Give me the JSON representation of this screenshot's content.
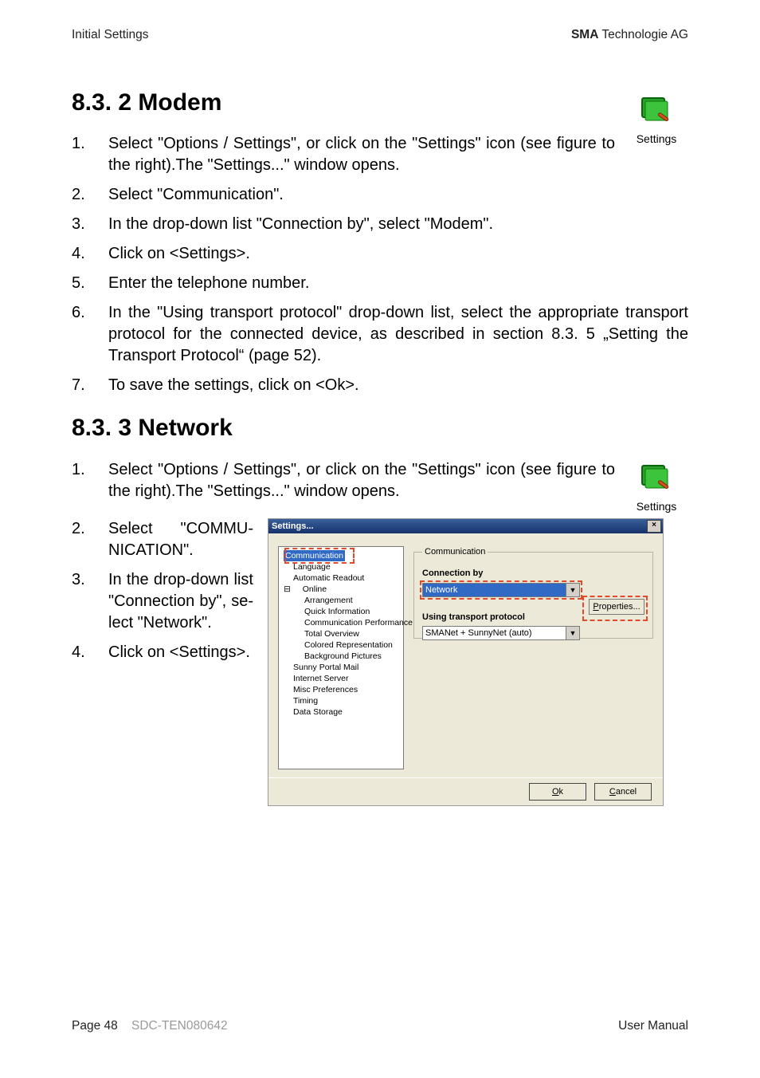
{
  "header": {
    "left": "Initial Settings",
    "right_bold": "SMA",
    "right_rest": " Technologie AG"
  },
  "icon": {
    "caption": "Settings"
  },
  "section_modem": {
    "heading": "8.3. 2 Modem",
    "steps": [
      "Select \"Options / Settings\", or click on the \"Settings\" icon (see figure to the right).The \"Settings...\" window opens.",
      "Select \"Communication\".",
      "In the drop-down list \"Connection by\", select \"Modem\".",
      "Click on <Settings>.",
      "Enter the telephone number.",
      "In the \"Using transport protocol\" drop-down list, select the appropriate transport protocol for the connected device, as described in section 8.3. 5 „Setting the Transport Protocol“ (page 52).",
      "To save the settings, click on <Ok>."
    ]
  },
  "section_network": {
    "heading": "8.3. 3 Network",
    "steps_top": [
      "Select \"Options / Settings\", or click on the \"Settings\" icon (see figure to the right).The \"Settings...\" window opens."
    ],
    "steps_left": [
      "Select \"COMMU-NICATION\".",
      "In the drop-down list \"Connection by\", se­lect \"Network\".",
      "Click on <Settings>."
    ]
  },
  "dialog": {
    "title": "Settings...",
    "tree": {
      "items": [
        {
          "label": "Communication",
          "lvl": 0,
          "selected": true
        },
        {
          "label": "Language",
          "lvl": 1
        },
        {
          "label": "Automatic Readout",
          "lvl": 1
        },
        {
          "label": "Online",
          "lvl": 1,
          "expand": true
        },
        {
          "label": "Arrangement",
          "lvl": 2
        },
        {
          "label": "Quick Information",
          "lvl": 2
        },
        {
          "label": "Communication Performance",
          "lvl": 2
        },
        {
          "label": "Total Overview",
          "lvl": 2
        },
        {
          "label": "Colored Representation",
          "lvl": 2
        },
        {
          "label": "Background Pictures",
          "lvl": 2
        },
        {
          "label": "Sunny Portal Mail",
          "lvl": 1
        },
        {
          "label": "Internet Server",
          "lvl": 1
        },
        {
          "label": "Misc Preferences",
          "lvl": 1
        },
        {
          "label": "Timing",
          "lvl": 1
        },
        {
          "label": "Data Storage",
          "lvl": 1
        }
      ]
    },
    "groupbox_title": "Communication",
    "connection_label": "Connection by",
    "connection_value": "Network",
    "properties_button": "Properties...",
    "transport_label": "Using transport protocol",
    "transport_value": "SMANet + SunnyNet (auto)",
    "ok": "Ok",
    "cancel": "Cancel"
  },
  "footer": {
    "left_a": "Page 48",
    "left_b": "SDC-TEN080642",
    "right": "User Manual"
  }
}
